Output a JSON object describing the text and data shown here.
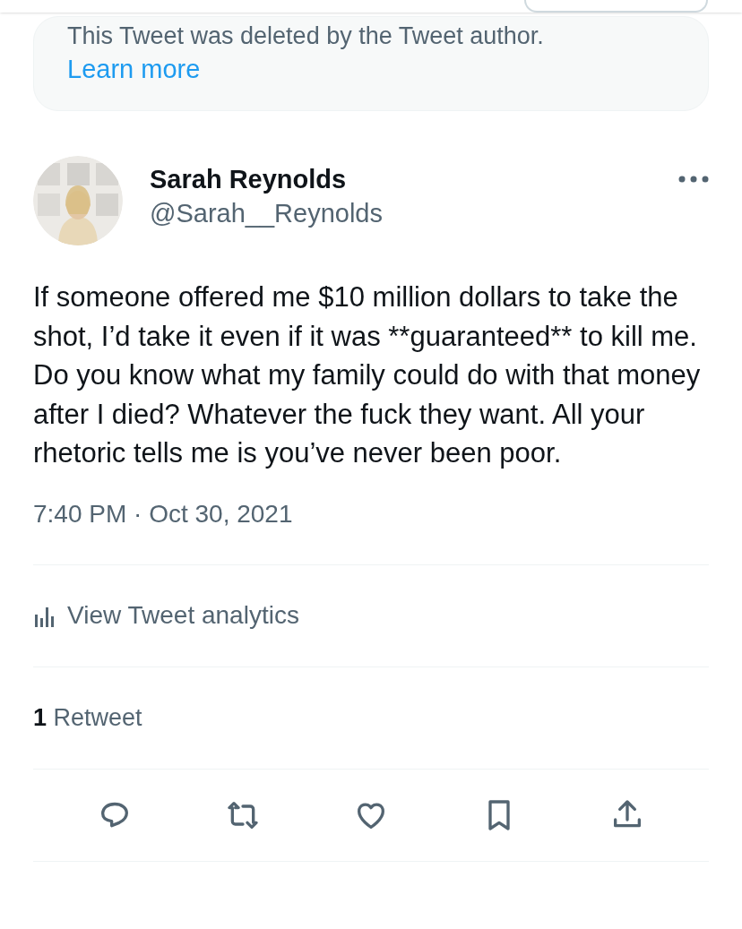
{
  "notice": {
    "text": "This Tweet was deleted by the Tweet author.",
    "link": "Learn more"
  },
  "tweet": {
    "name": "Sarah Reynolds",
    "handle": "@Sarah__Reynolds",
    "body": "If someone offered me $10 million dollars to take the shot, I’d take it even if it was **guaranteed** to kill me. Do you know what my family could do with that money after I died? Whatever the fuck they want. All your rhetoric tells me is you’ve never been poor.",
    "timestamp": "7:40 PM · Oct 30, 2021"
  },
  "analytics": {
    "label": "View Tweet analytics"
  },
  "stats": [
    {
      "count": "1",
      "label": "Retweet"
    }
  ],
  "actions": [
    {
      "kind": "reply"
    },
    {
      "kind": "retweet"
    },
    {
      "kind": "like"
    },
    {
      "kind": "bookmark"
    },
    {
      "kind": "share"
    }
  ]
}
